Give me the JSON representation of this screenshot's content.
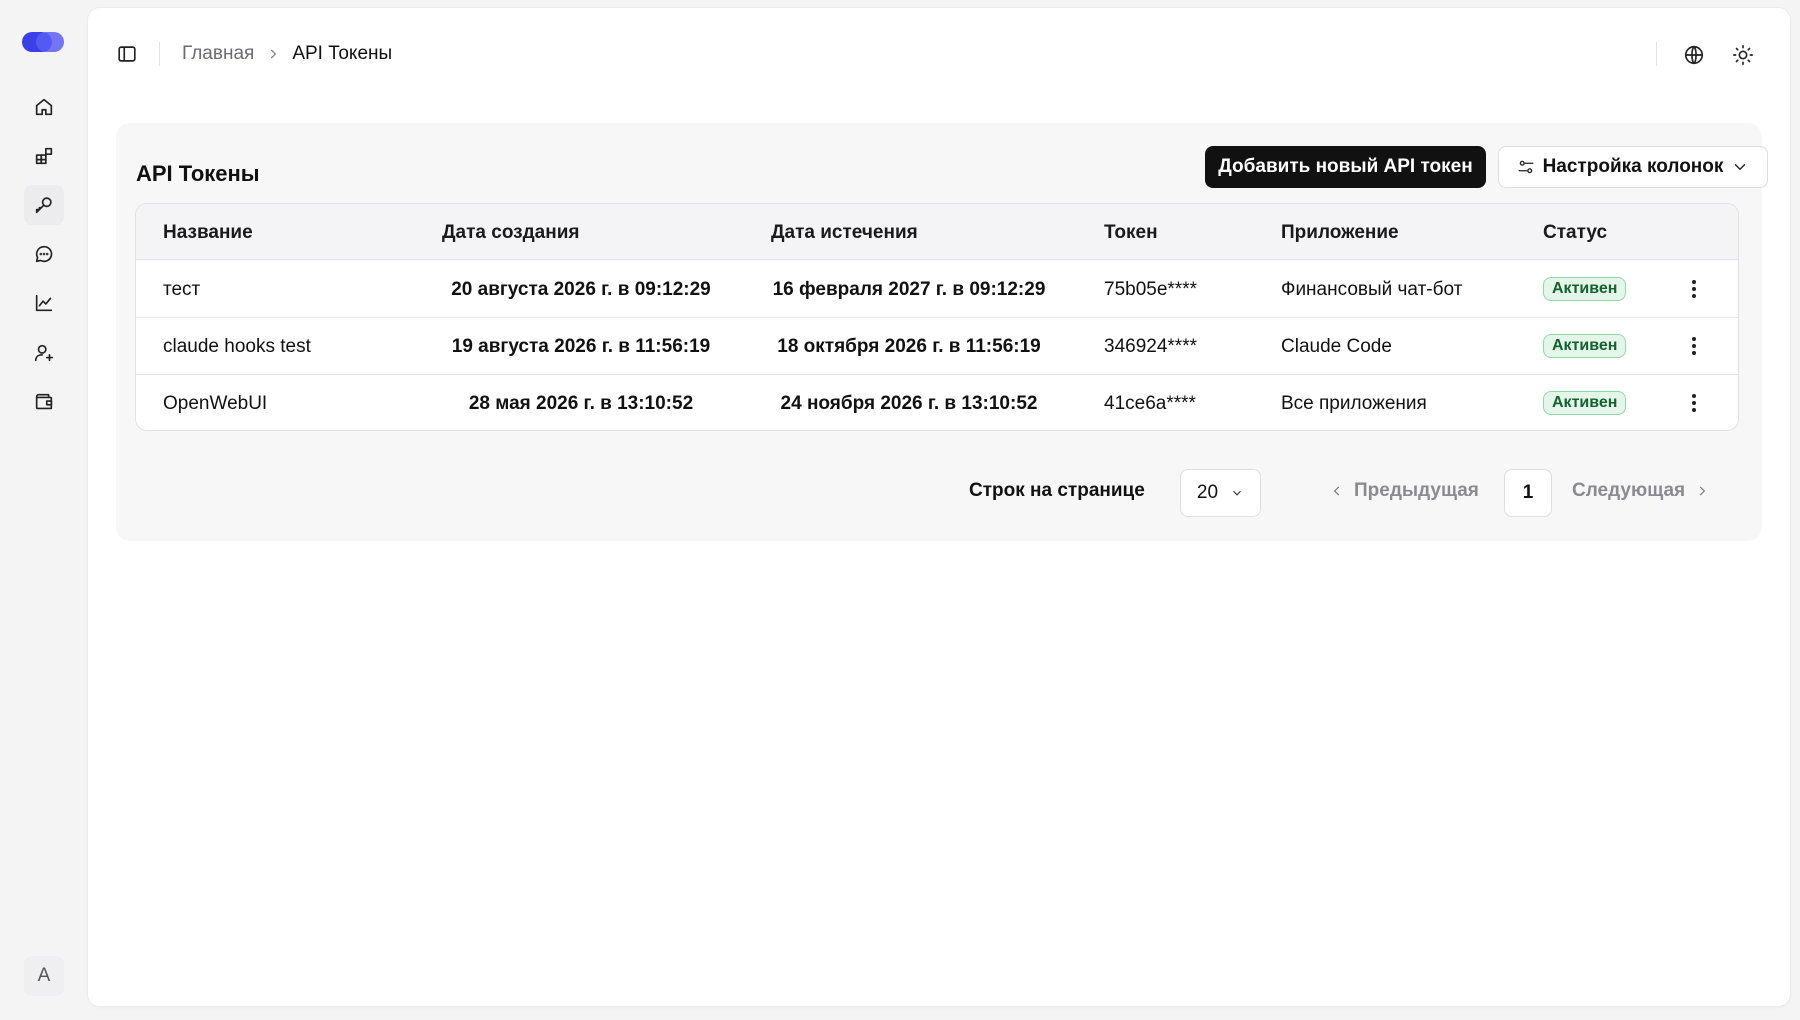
{
  "colors": {
    "accent": "#4b4ff0",
    "primary_button": "#111111",
    "badge_bg": "#e4f6ea",
    "badge_text": "#15622f"
  },
  "sidebar": {
    "items": [
      {
        "icon": "home-icon"
      },
      {
        "icon": "apps-icon"
      },
      {
        "icon": "key-icon",
        "active": true
      },
      {
        "icon": "chat-icon"
      },
      {
        "icon": "chart-icon"
      },
      {
        "icon": "user-add-icon"
      },
      {
        "icon": "wallet-icon"
      }
    ],
    "avatar": "A"
  },
  "header": {
    "breadcrumb": {
      "home": "Главная",
      "current": "API Токены"
    }
  },
  "card": {
    "title": "API Токены",
    "add_button": "Добавить новый API токен",
    "columns_button": "Настройка колонок"
  },
  "table": {
    "headers": [
      "Название",
      "Дата создания",
      "Дата истечения",
      "Токен",
      "Приложение",
      "Статус"
    ],
    "rows": [
      {
        "name": "тест",
        "created": "20 августа 2026 г. в 09:12:29",
        "expires": "16 февраля 2027 г. в 09:12:29",
        "token": "75b05e****",
        "app": "Финансовый чат-бот",
        "status": "Активен"
      },
      {
        "name": "claude hooks test",
        "created": "19 августа 2026 г. в 11:56:19",
        "expires": "18 октября 2026 г. в 11:56:19",
        "token": "346924****",
        "app": "Claude Code",
        "status": "Активен"
      },
      {
        "name": "OpenWebUI",
        "created": "28 мая 2026 г. в 13:10:52",
        "expires": "24 ноября 2026 г. в 13:10:52",
        "token": "41ce6a****",
        "app": "Все приложения",
        "status": "Активен"
      }
    ]
  },
  "pagination": {
    "rows_label": "Строк на странице",
    "rows_value": "20",
    "prev": "Предыдущая",
    "page": "1",
    "next": "Следующая"
  }
}
